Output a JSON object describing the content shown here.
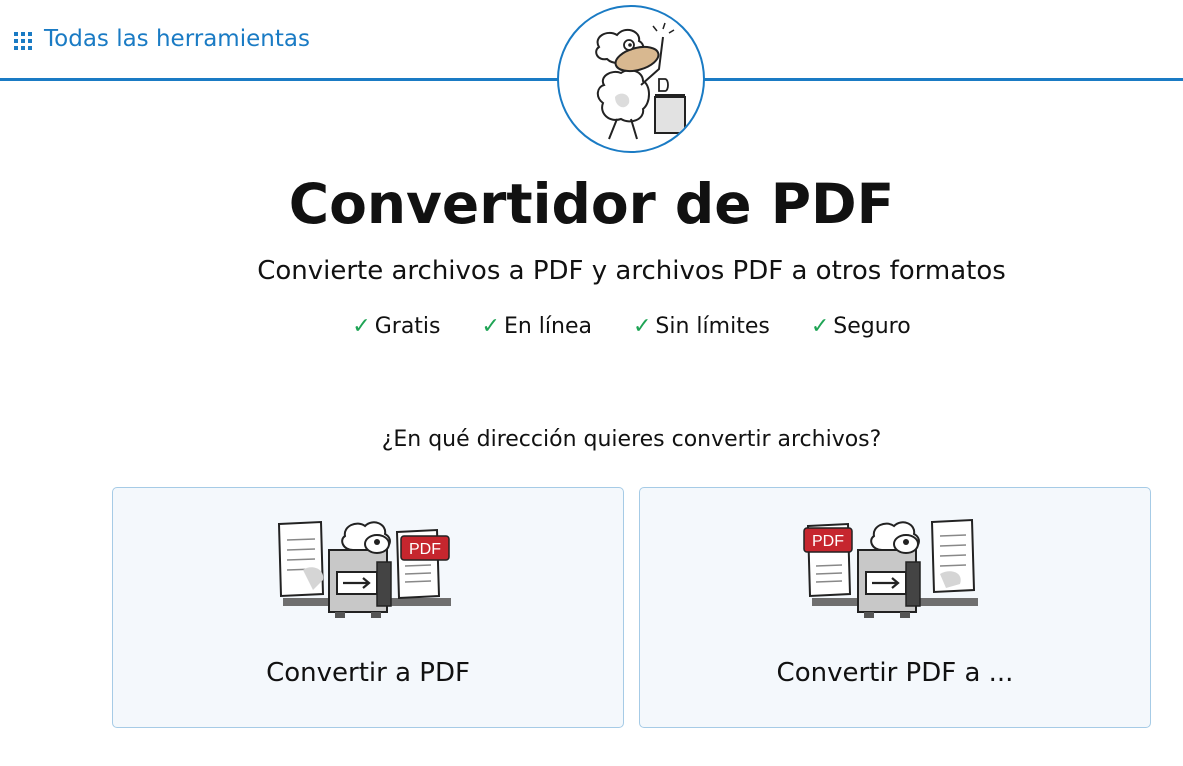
{
  "header": {
    "all_tools_label": "Todas las herramientas"
  },
  "hero": {
    "title": "Convertidor de PDF",
    "subtitle": "Convierte archivos a PDF y archivos PDF a otros formatos",
    "features": [
      {
        "check": "✓",
        "label": "Gratis"
      },
      {
        "check": "✓",
        "label": "En línea"
      },
      {
        "check": "✓",
        "label": "Sin límites"
      },
      {
        "check": "✓",
        "label": "Seguro"
      }
    ]
  },
  "direction": {
    "question": "¿En qué dirección quieres convertir archivos?",
    "options": [
      {
        "label": "Convertir a PDF",
        "icon": "convert-to-pdf-icon",
        "badge": "PDF"
      },
      {
        "label": "Convertir PDF a ...",
        "icon": "convert-from-pdf-icon",
        "badge": "PDF"
      }
    ]
  },
  "colors": {
    "accent": "#1a7bc4",
    "check": "#1fa455",
    "card_bg": "#f4f8fc",
    "pdf_red": "#c6262e"
  }
}
